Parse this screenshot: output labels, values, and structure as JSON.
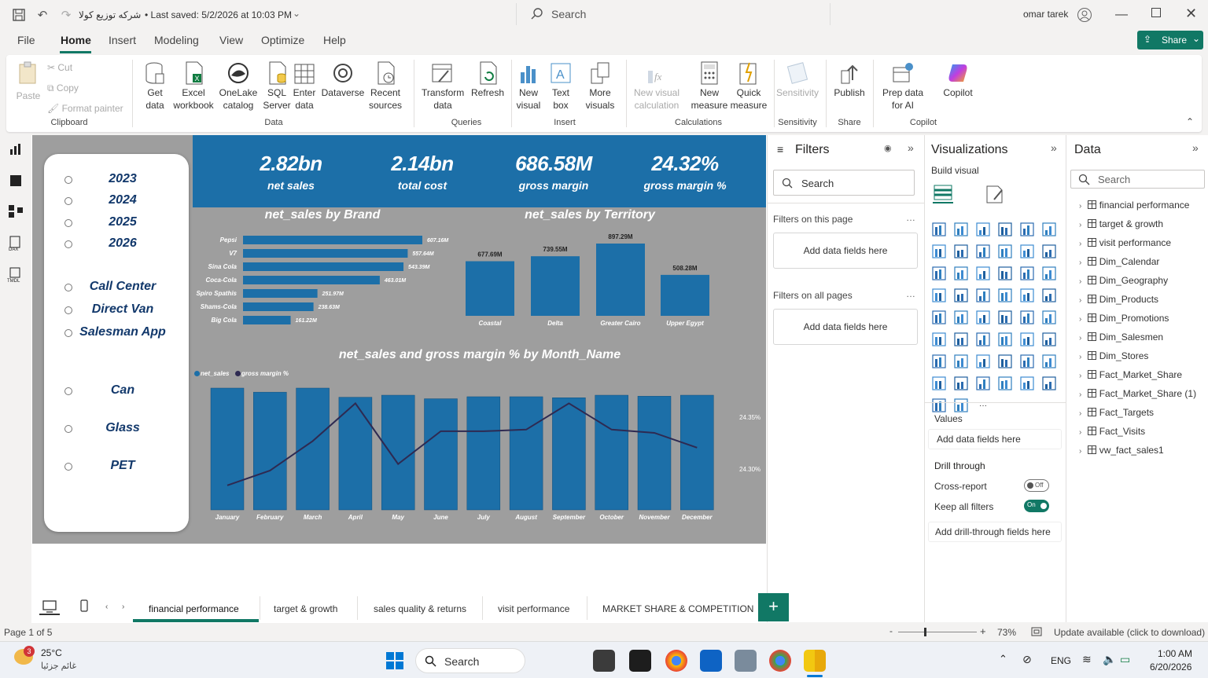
{
  "titlebar": {
    "doc_title": "شركه توزيع كولا",
    "saved": "• Last saved: 5/2/2026 at 10:03 PM",
    "search": "Search",
    "user": "omar tarek"
  },
  "menu": [
    "File",
    "Home",
    "Insert",
    "Modeling",
    "View",
    "Optimize",
    "Help"
  ],
  "share_label": "Share",
  "ribbon": {
    "paste": "Paste",
    "cut": "Cut",
    "copy": "Copy",
    "format_painter": "Format painter",
    "clipboard": "Clipboard",
    "get_data": "Get data",
    "excel": "Excel workbook",
    "onelake": "OneLake catalog",
    "sql": "SQL Server",
    "enter": "Enter data",
    "dataverse": "Dataverse",
    "recent": "Recent sources",
    "data": "Data",
    "transform": "Transform data",
    "refresh": "Refresh",
    "queries": "Queries",
    "new_visual": "New visual",
    "text_box": "Text box",
    "more_visuals": "More visuals",
    "insert": "Insert",
    "new_visual_calc": "New visual calculation",
    "new_measure": "New measure",
    "quick_measure": "Quick measure",
    "calculations": "Calculations",
    "sensitivity": "Sensitivity",
    "sensitivity_grp": "Sensitivity",
    "publish": "Publish",
    "share_grp": "Share",
    "prep_ai": "Prep data for AI",
    "copilot": "Copilot",
    "copilot_grp": "Copilot"
  },
  "slicer": {
    "years": [
      "2023",
      "2024",
      "2025",
      "2026"
    ],
    "channels": [
      "Call Center",
      "Direct Van",
      "Salesman App"
    ],
    "packs": [
      "Can",
      "Glass",
      "PET"
    ]
  },
  "kpis": [
    {
      "value": "2.82bn",
      "label": "net sales"
    },
    {
      "value": "2.14bn",
      "label": "total cost"
    },
    {
      "value": "686.58M",
      "label": "gross margin"
    },
    {
      "value": "24.32%",
      "label": "gross margin %"
    }
  ],
  "chart_data": [
    {
      "type": "bar",
      "orientation": "horizontal",
      "title": "net_sales by Brand",
      "categories": [
        "Pepsi",
        "V7",
        "Sina Cola",
        "Coca-Cola",
        "Spiro Spathis",
        "Shams-Cola",
        "Big Cola"
      ],
      "values": [
        607.16,
        557.64,
        543.39,
        463.01,
        251.97,
        238.63,
        161.22
      ],
      "labels": [
        "607.16M",
        "557.64M",
        "543.39M",
        "463.01M",
        "251.97M",
        "238.63M",
        "161.22M"
      ]
    },
    {
      "type": "bar",
      "title": "net_sales by Territory",
      "categories": [
        "Coastal",
        "Delta",
        "Greater Cairo",
        "Upper Egypt"
      ],
      "values": [
        677.69,
        739.55,
        897.29,
        508.28
      ],
      "labels": [
        "677.69M",
        "739.55M",
        "897.29M",
        "508.28M"
      ]
    },
    {
      "type": "bar",
      "title": "net_sales and gross margin % by Month_Name",
      "categories": [
        "January",
        "February",
        "March",
        "April",
        "May",
        "June",
        "July",
        "August",
        "September",
        "October",
        "November",
        "December"
      ],
      "series": [
        {
          "name": "net_sales",
          "values": [
            240,
            232,
            240,
            222,
            226,
            219,
            223,
            223,
            221,
            226,
            224,
            226
          ]
        },
        {
          "name": "gross margin %",
          "values": [
            24.294,
            24.303,
            24.321,
            24.344,
            24.307,
            24.327,
            24.327,
            24.328,
            24.344,
            24.328,
            24.326,
            24.317
          ]
        }
      ],
      "y2_ticks": [
        "24.35%",
        "24.30%"
      ]
    }
  ],
  "filters": {
    "title": "Filters",
    "search": "Search",
    "on_page": "Filters on this page",
    "all_pages": "Filters on all pages",
    "add": "Add data fields here"
  },
  "viz": {
    "title": "Visualizations",
    "build": "Build visual",
    "values": "Values",
    "add": "Add data fields here",
    "drill": "Drill through",
    "cross": "Cross-report",
    "cross_state": "Off",
    "keep": "Keep all filters",
    "keep_state": "On",
    "add_drill": "Add drill-through fields here"
  },
  "data_pane": {
    "title": "Data",
    "search": "Search",
    "fields": [
      "financial performance",
      "target & growth",
      "visit performance",
      "Dim_Calendar",
      "Dim_Geography",
      "Dim_Products",
      "Dim_Promotions",
      "Dim_Salesmen",
      "Dim_Stores",
      "Fact_Market_Share",
      "Fact_Market_Share (1)",
      "Fact_Targets",
      "Fact_Visits",
      "vw_fact_sales1"
    ]
  },
  "tabs": [
    "financial performance",
    "target & growth",
    "sales quality & returns",
    "visit performance",
    "MARKET SHARE & COMPETITION"
  ],
  "status": {
    "page": "Page 1 of 5",
    "zoom": "73%",
    "update": "Update available (click to download)"
  },
  "taskbar": {
    "temp": "25°C",
    "weather": "غائم جزئيا",
    "search": "Search",
    "lang": "ENG",
    "time": "1:00 AM",
    "date": "6/20/2026",
    "badge": "3"
  }
}
